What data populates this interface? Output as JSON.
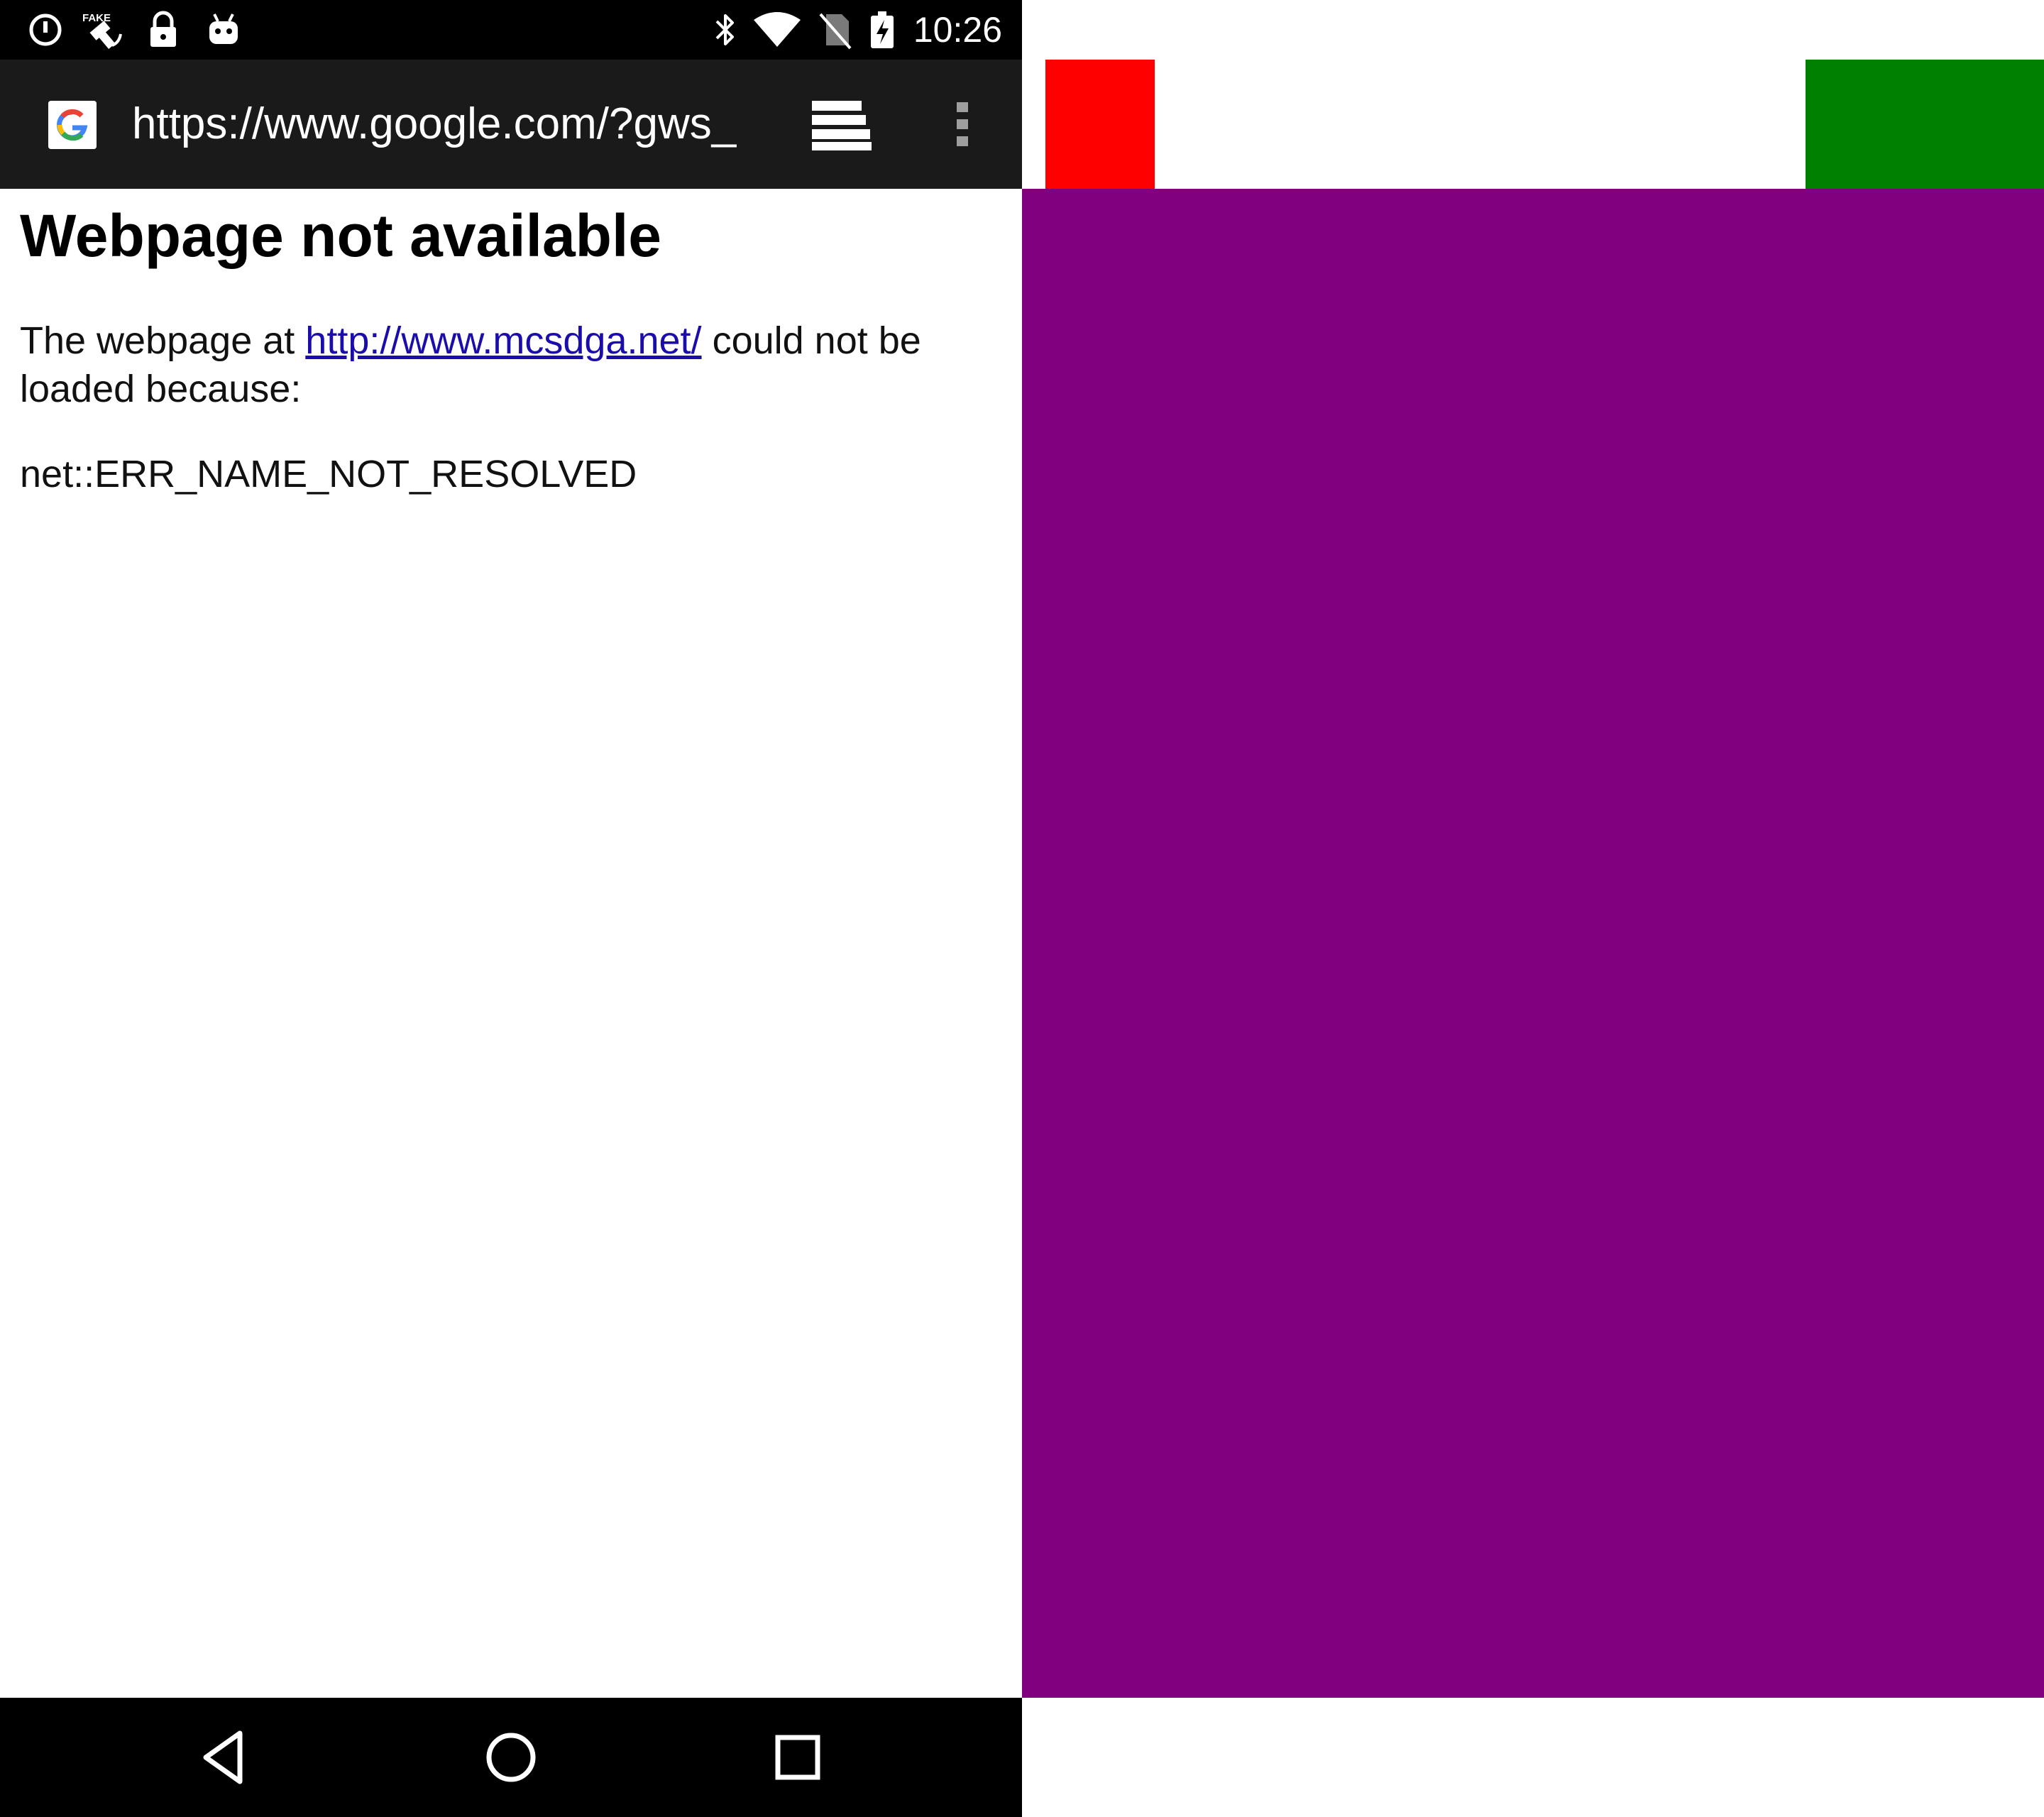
{
  "status_bar": {
    "time": "10:26",
    "icons": [
      "circle-info-icon",
      "fake-gps-icon",
      "lock-icon",
      "android-icon",
      "bluetooth-icon",
      "wifi-icon",
      "no-sim-icon",
      "battery-charging-icon"
    ]
  },
  "toolbar": {
    "url": "https://www.google.com/?gws_",
    "favicon": "google-g-icon",
    "tabs_icon": "tabs-stack-icon",
    "menu_icon": "overflow-menu-icon"
  },
  "error_page": {
    "heading": "Webpage not available",
    "message_prefix": "The webpage at",
    "link_text": "http://www.mcsdga.net/",
    "message_suffix": "could not be loaded because:",
    "error_code": "net::ERR_NAME_NOT_RESOLVED"
  },
  "nav_bar": {
    "buttons": [
      "back-icon",
      "home-icon",
      "recents-icon"
    ]
  },
  "colors": {
    "status_bar_bg": "#000000",
    "toolbar_bg": "#1a1a1a",
    "link": "#1a0dab",
    "red_block": "#ff0000",
    "green_block": "#008000",
    "purple_block": "#800080"
  }
}
